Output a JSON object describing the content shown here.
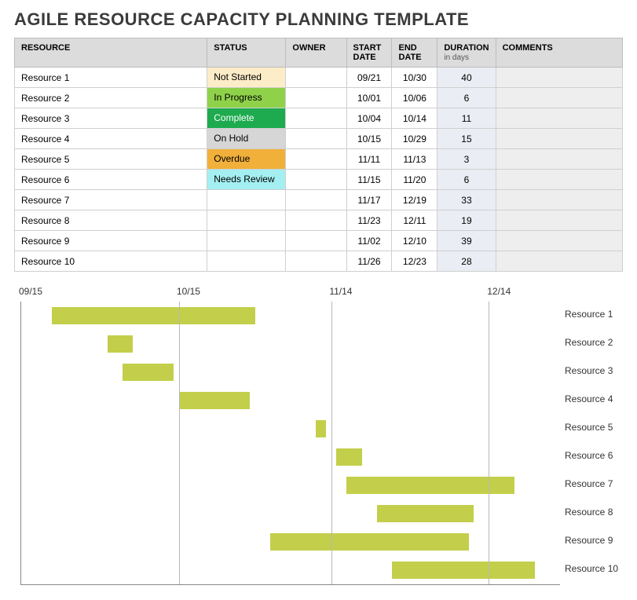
{
  "title": "AGILE RESOURCE CAPACITY PLANNING TEMPLATE",
  "headers": {
    "resource": "RESOURCE",
    "status": "STATUS",
    "owner": "OWNER",
    "start": "START DATE",
    "end": "END DATE",
    "duration": "DURATION",
    "duration_sub": "in days",
    "comments": "COMMENTS"
  },
  "status_colors": {
    "Not Started": "#fcecc8",
    "In Progress": "#8fd24a",
    "Complete": "#1eab4f",
    "On Hold": "#d6d6d6",
    "Overdue": "#f0b03a",
    "Needs Review": "#a4eff1"
  },
  "rows": [
    {
      "resource": "Resource 1",
      "status": "Not Started",
      "owner": "",
      "start": "09/21",
      "end": "10/30",
      "duration": "40",
      "comments": ""
    },
    {
      "resource": "Resource 2",
      "status": "In Progress",
      "owner": "",
      "start": "10/01",
      "end": "10/06",
      "duration": "6",
      "comments": ""
    },
    {
      "resource": "Resource 3",
      "status": "Complete",
      "owner": "",
      "start": "10/04",
      "end": "10/14",
      "duration": "11",
      "comments": ""
    },
    {
      "resource": "Resource 4",
      "status": "On Hold",
      "owner": "",
      "start": "10/15",
      "end": "10/29",
      "duration": "15",
      "comments": ""
    },
    {
      "resource": "Resource 5",
      "status": "Overdue",
      "owner": "",
      "start": "11/11",
      "end": "11/13",
      "duration": "3",
      "comments": ""
    },
    {
      "resource": "Resource 6",
      "status": "Needs Review",
      "owner": "",
      "start": "11/15",
      "end": "11/20",
      "duration": "6",
      "comments": ""
    },
    {
      "resource": "Resource 7",
      "status": "",
      "owner": "",
      "start": "11/17",
      "end": "12/19",
      "duration": "33",
      "comments": ""
    },
    {
      "resource": "Resource 8",
      "status": "",
      "owner": "",
      "start": "11/23",
      "end": "12/11",
      "duration": "19",
      "comments": ""
    },
    {
      "resource": "Resource 9",
      "status": "",
      "owner": "",
      "start": "11/02",
      "end": "12/10",
      "duration": "39",
      "comments": ""
    },
    {
      "resource": "Resource 10",
      "status": "",
      "owner": "",
      "start": "11/26",
      "end": "12/23",
      "duration": "28",
      "comments": ""
    }
  ],
  "chart_data": {
    "type": "bar",
    "orientation": "horizontal-gantt",
    "x_start": "09/15",
    "x_end": "12/28",
    "ticks": [
      "09/15",
      "10/15",
      "11/14",
      "12/14"
    ],
    "bar_color": "#c3cf4a",
    "series": [
      {
        "name": "Resource 1",
        "start": "09/21",
        "end": "10/30"
      },
      {
        "name": "Resource 2",
        "start": "10/01",
        "end": "10/06"
      },
      {
        "name": "Resource 3",
        "start": "10/04",
        "end": "10/14"
      },
      {
        "name": "Resource 4",
        "start": "10/15",
        "end": "10/29"
      },
      {
        "name": "Resource 5",
        "start": "11/11",
        "end": "11/13"
      },
      {
        "name": "Resource 6",
        "start": "11/15",
        "end": "11/20"
      },
      {
        "name": "Resource 7",
        "start": "11/17",
        "end": "12/19"
      },
      {
        "name": "Resource 8",
        "start": "11/23",
        "end": "12/11"
      },
      {
        "name": "Resource 9",
        "start": "11/02",
        "end": "12/10"
      },
      {
        "name": "Resource 10",
        "start": "11/26",
        "end": "12/23"
      }
    ]
  }
}
